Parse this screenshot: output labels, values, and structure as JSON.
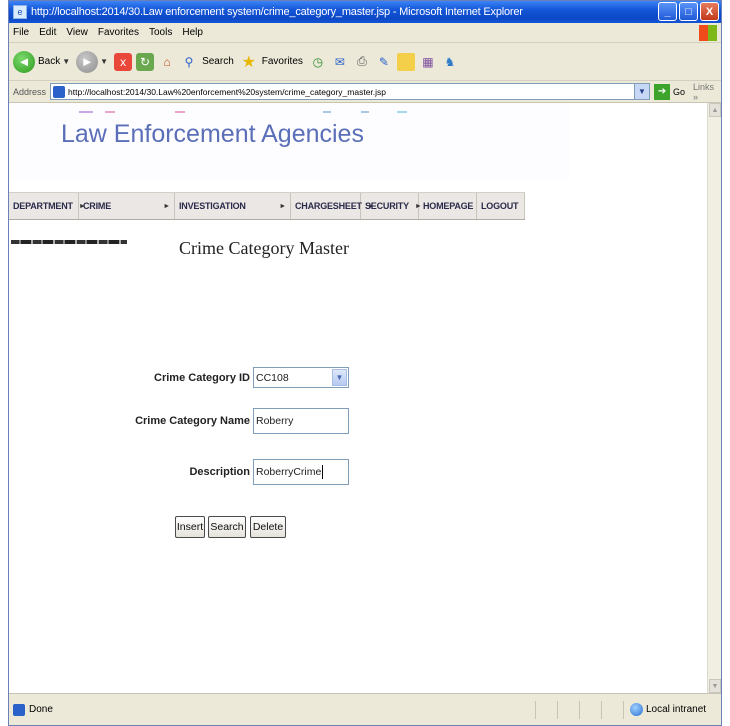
{
  "window": {
    "title": "http://localhost:2014/30.Law enforcement system/crime_category_master.jsp - Microsoft Internet Explorer"
  },
  "menubar": [
    "File",
    "Edit",
    "View",
    "Favorites",
    "Tools",
    "Help"
  ],
  "toolbar": {
    "back": "Back",
    "search": "Search",
    "favorites": "Favorites"
  },
  "address": {
    "label": "Address",
    "url": "http://localhost:2014/30.Law%20enforcement%20system/crime_category_master.jsp",
    "go": "Go",
    "links": "Links"
  },
  "banner": {
    "title": "Law Enforcement Agencies"
  },
  "nav": [
    {
      "label": "DEPARTMENT",
      "caret": "►"
    },
    {
      "label": "CRIME",
      "caret": "►"
    },
    {
      "label": "INVESTIGATION",
      "caret": "►"
    },
    {
      "label": "CHARGESHEET",
      "caret": "►"
    },
    {
      "label": "SECURITY",
      "caret": "►"
    },
    {
      "label": "HOMEPAGE",
      "caret": ""
    },
    {
      "label": "LOGOUT",
      "caret": ""
    }
  ],
  "page": {
    "heading": "Crime Category Master"
  },
  "form": {
    "id_label": "Crime Category ID",
    "id_value": "CC108",
    "name_label": "Crime Category Name",
    "name_value": "Roberry",
    "desc_label": "Description",
    "desc_value": "RoberryCrime"
  },
  "buttons": {
    "insert": "Insert",
    "search": "Search",
    "delete": "Delete"
  },
  "status": {
    "text": "Done",
    "zone": "Local intranet"
  }
}
